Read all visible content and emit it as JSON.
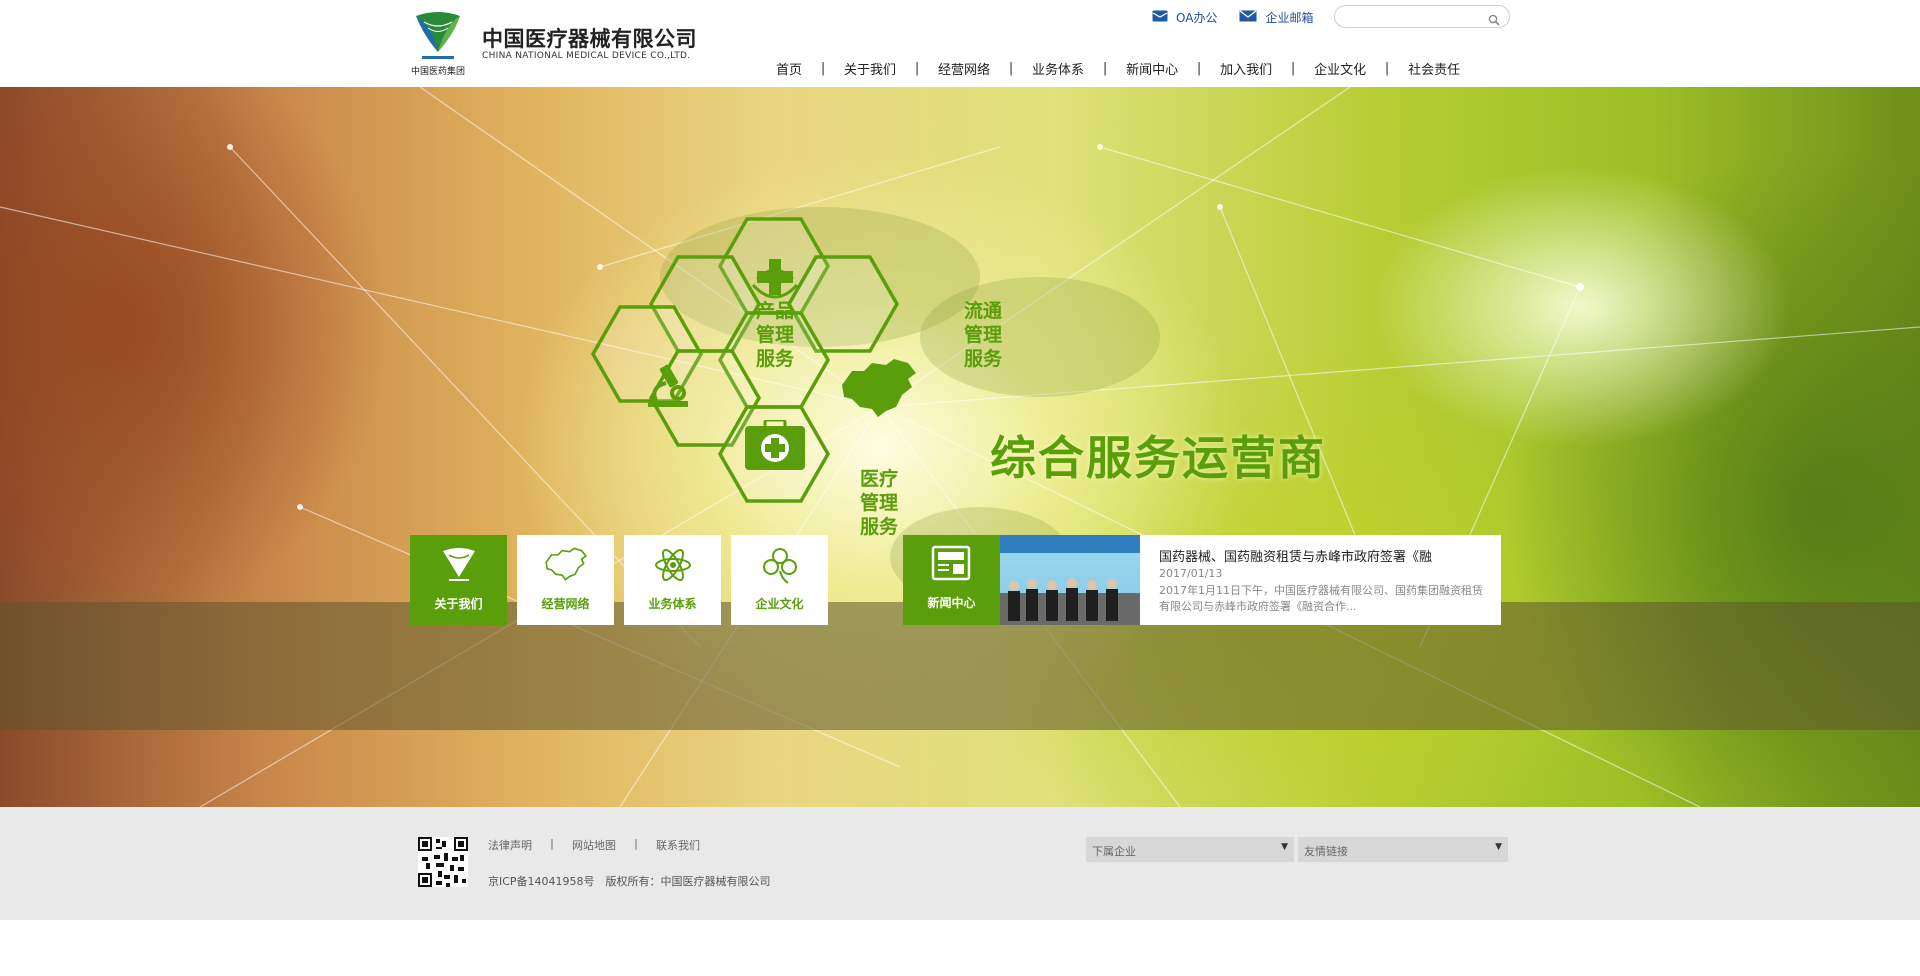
{
  "header": {
    "brand_cn": "中国医疗器械有限公司",
    "brand_en": "CHINA NATIONAL MEDICAL DEVICE CO.,LTD.",
    "logo_caption": "中国医药集团",
    "top_links": [
      {
        "label": "OA办公",
        "icon": "inbox-icon"
      },
      {
        "label": "企业邮箱",
        "icon": "envelope-icon"
      }
    ],
    "search": {
      "value": "",
      "placeholder": ""
    },
    "nav": [
      "首页",
      "关于我们",
      "经营网络",
      "业务体系",
      "新闻中心",
      "加入我们",
      "企业文化",
      "社会责任"
    ],
    "nav_separator": "|"
  },
  "banner": {
    "slogan": "综合服务运营商",
    "hexagons": [
      {
        "text": "产品管理服务"
      },
      {
        "text": "流通管理服务"
      },
      {
        "text": "医疗管理服务"
      },
      {
        "icon": "medical-cross-icon"
      },
      {
        "icon": "microscope-icon"
      },
      {
        "icon": "china-map-icon"
      },
      {
        "icon": "first-aid-kit-icon"
      }
    ],
    "hex_lines": {
      "product": [
        "产品",
        "管理",
        "服务"
      ],
      "logistics": [
        "流通",
        "管理",
        "服务"
      ],
      "medical": [
        "医疗",
        "管理",
        "服务"
      ]
    },
    "accent_color": "#5a9e0b"
  },
  "quick_links": [
    {
      "label": "关于我们",
      "icon": "umbrella-logo-icon",
      "active": true
    },
    {
      "label": "经营网络",
      "icon": "china-map-icon",
      "active": false
    },
    {
      "label": "业务体系",
      "icon": "atom-icon",
      "active": false
    },
    {
      "label": "企业文化",
      "icon": "clover-icon",
      "active": false
    }
  ],
  "news": {
    "tab_label": "新闻中心",
    "title": "国药器械、国药融资租赁与赤峰市政府签署《融",
    "date": "2017/01/13",
    "summary": "2017年1月11日下午，中国医疗器械有限公司、国药集团融资租赁有限公司与赤峰市政府签署《融资合作..."
  },
  "footer": {
    "links": [
      "法律声明",
      "网站地图",
      "联系我们"
    ],
    "separator": "|",
    "copyright": "京ICP备14041958号　版权所有：中国医疗器械有限公司",
    "selects": [
      {
        "value": "下属企业"
      },
      {
        "value": "友情链接"
      }
    ],
    "select_arrow": "▼"
  }
}
